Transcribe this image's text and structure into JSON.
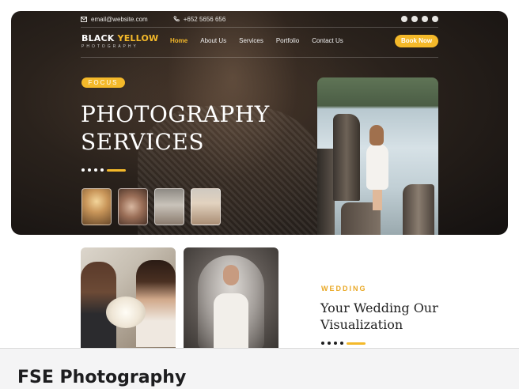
{
  "topbar": {
    "email": "email@website.com",
    "phone": "+652 5656 656",
    "social_icons": [
      "pinterest-icon",
      "twitter-icon",
      "youtube-icon",
      "instagram-icon"
    ]
  },
  "logo": {
    "word1": "BLACK",
    "word2": "YELLOW",
    "tagline": "PHOTOGRAPHY"
  },
  "nav": {
    "items": [
      "Home",
      "About Us",
      "Services",
      "Portfolio",
      "Contact Us"
    ],
    "active": "Home",
    "cta": "Book Now"
  },
  "hero": {
    "badge": "FOCUS",
    "title_line1": "PHOTOGRAPHY",
    "title_line2": "SERVICES"
  },
  "section": {
    "label": "WEDDING",
    "title_line1": "Your Wedding Our",
    "title_line2": "Visualization"
  },
  "footer": {
    "title": "FSE Photography"
  },
  "colors": {
    "accent": "#f4b92a",
    "dark": "#1a1614",
    "footer_bg": "#f4f4f5"
  }
}
